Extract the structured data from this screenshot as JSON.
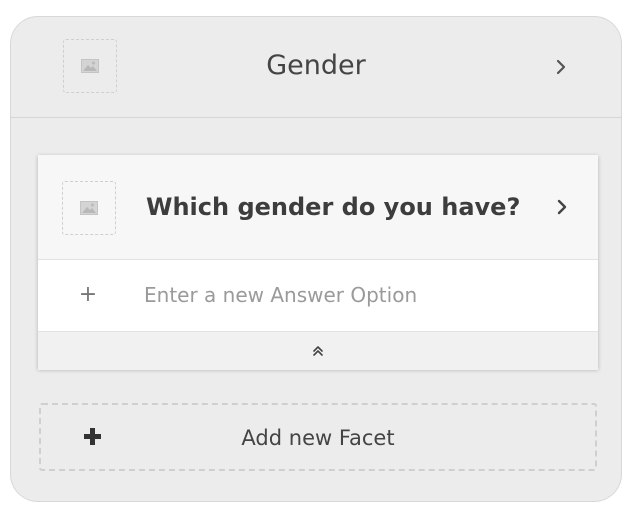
{
  "facet": {
    "title": "Gender",
    "image_icon": "image-icon",
    "open_icon": "chevron-right-icon"
  },
  "question": {
    "text": "Which gender do you have?",
    "image_icon": "image-icon",
    "open_icon": "chevron-right-icon"
  },
  "answer_option": {
    "add_symbol": "+",
    "placeholder": "Enter a new Answer Option",
    "value": ""
  },
  "collapse": {
    "icon": "double-chevron-up-icon"
  },
  "add_facet": {
    "icon": "plus-icon",
    "label": "Add new Facet"
  },
  "colors": {
    "card_background": "#ececec",
    "text_primary": "#444444",
    "placeholder": "#9a9a9a",
    "dashed_border": "#cfcfcf"
  }
}
